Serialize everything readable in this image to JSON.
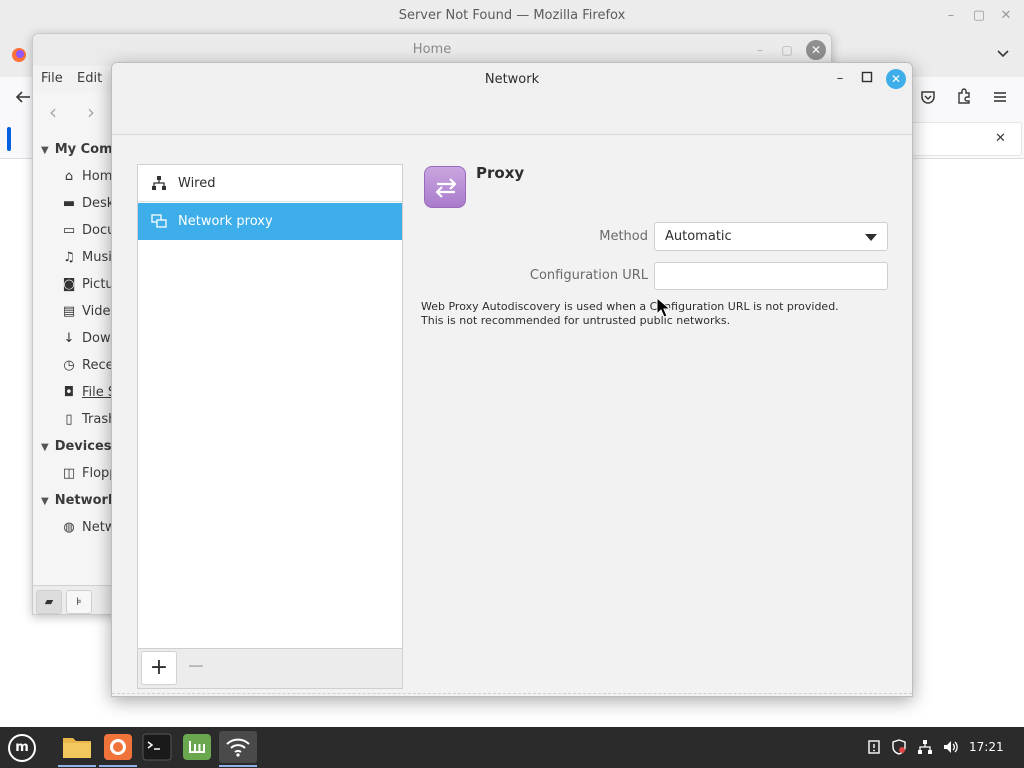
{
  "firefox": {
    "window_title": "Server Not Found — Mozilla Firefox",
    "controls": {
      "minimize": "–",
      "maximize": "▢",
      "close": "✕"
    },
    "notice_close": "✕"
  },
  "nemo": {
    "window_title": "Home",
    "menus": [
      "File",
      "Edit"
    ],
    "sidebar": {
      "sections": [
        {
          "title": "My Comp",
          "items": [
            {
              "icon": "home-icon",
              "label": "Home"
            },
            {
              "icon": "desktop-icon",
              "label": "Desk"
            },
            {
              "icon": "documents-icon",
              "label": "Docu"
            },
            {
              "icon": "music-icon",
              "label": "Musi"
            },
            {
              "icon": "pictures-icon",
              "label": "Pictu"
            },
            {
              "icon": "videos-icon",
              "label": "Vide"
            },
            {
              "icon": "downloads-icon",
              "label": "Dow"
            },
            {
              "icon": "recent-icon",
              "label": "Rece"
            },
            {
              "icon": "filesystem-icon",
              "label": "File S"
            },
            {
              "icon": "trash-icon",
              "label": "Trash"
            }
          ]
        },
        {
          "title": "Devices",
          "items": [
            {
              "icon": "floppy-icon",
              "label": "Flopp"
            }
          ]
        },
        {
          "title": "Network",
          "items": [
            {
              "icon": "globe-icon",
              "label": "Netw"
            }
          ]
        }
      ]
    }
  },
  "network": {
    "window_title": "Network",
    "connections": [
      {
        "label": "Wired",
        "icon": "wired-icon",
        "selected": false
      },
      {
        "label": "Network proxy",
        "icon": "proxy-list-icon",
        "selected": true
      }
    ],
    "add_label": "+",
    "remove_label": "−",
    "panel": {
      "title": "Proxy",
      "method_label": "Method",
      "method_value": "Automatic",
      "config_url_label": "Configuration URL",
      "config_url_value": "",
      "help_line1": "Web Proxy Autodiscovery is used when a Configuration URL is not provided.",
      "help_line2": "This is not recommended for untrusted public networks."
    },
    "accent": "#3daee9"
  },
  "taskbar": {
    "apps": [
      {
        "name": "files",
        "color": "#e8b64a"
      },
      {
        "name": "firefox",
        "color": "#f0743a"
      },
      {
        "name": "terminal",
        "color": "#1a1a1a"
      },
      {
        "name": "mint-update",
        "color": "#6aa84f"
      },
      {
        "name": "network",
        "color": "#5a5a5a"
      }
    ],
    "clock": "17:21"
  }
}
